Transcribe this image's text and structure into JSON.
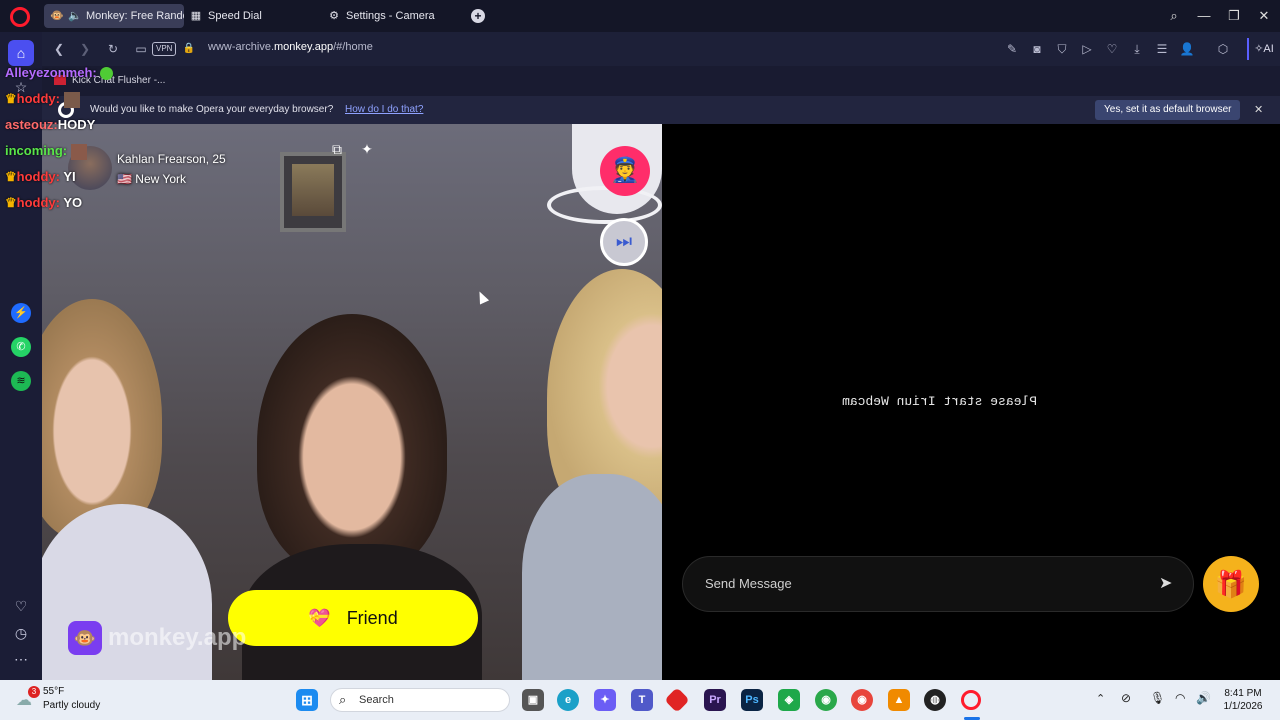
{
  "tabs": [
    {
      "label": "Monkey: Free Random"
    },
    {
      "label": "Speed Dial"
    },
    {
      "label": "Settings - Camera"
    }
  ],
  "url": {
    "prefix": "www-archive.",
    "domain": "monkey.app",
    "suffix": "/#/home"
  },
  "nav": {
    "vpn_label": "VPN",
    "ai_label": "AI"
  },
  "bookmarks": [
    {
      "label": "Kick Chat Flusher -..."
    }
  ],
  "infobar": {
    "message": "Would you like to make Opera your everyday browser?",
    "link": "How do I do that?",
    "button": "Yes, set it as default browser"
  },
  "chat_overlay": [
    {
      "user": "Alleyezonmeh:",
      "text": "",
      "color": "#b56cff",
      "crown": false
    },
    {
      "user": "hoddy:",
      "text": "",
      "color": "#ff3b3b",
      "crown": true
    },
    {
      "user": "asteouz:",
      "text": "HODY",
      "color": "#ff6b6b",
      "crown": false
    },
    {
      "user": "incoming:",
      "text": "",
      "color": "#59e64a",
      "crown": false
    },
    {
      "user": "hoddy:",
      "text": "YI",
      "color": "#ff3b3b",
      "crown": true
    },
    {
      "user": "hoddy:",
      "text": "YO",
      "color": "#ff3b3b",
      "crown": true
    }
  ],
  "partner": {
    "name": "Kahlan Frearson, 25",
    "flag": "🇺🇸",
    "location": "New York"
  },
  "friend_button": {
    "emoji": "💝",
    "label": "Friend"
  },
  "watermark": "monkey.app",
  "right_panel": {
    "message": "Please start Iriun Webcam",
    "send_placeholder": "Send Message"
  },
  "taskbar": {
    "weather_temp": "55°F",
    "weather_desc": "Partly cloudy",
    "weather_badge": "3",
    "search_placeholder": "Search",
    "time": "8:41 PM",
    "date": "1/1/2026"
  },
  "colors": {
    "friend_button": "#ffff00",
    "tab_active": "#3a3d58",
    "titlebar": "#141627",
    "taskbar": "#e9eef6",
    "gift_button": "#f5b21c"
  }
}
